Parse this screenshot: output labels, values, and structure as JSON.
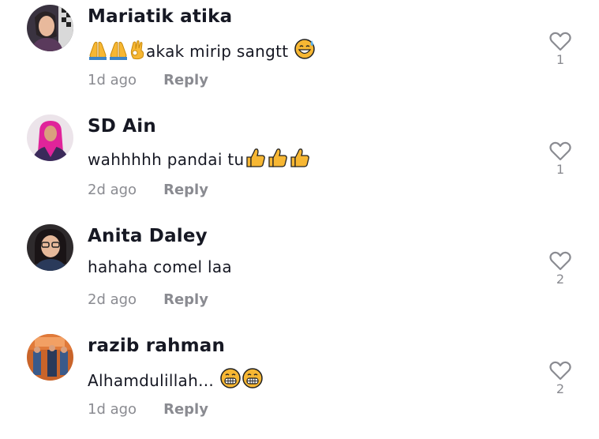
{
  "comments": [
    {
      "username": "Mariatik atika",
      "emoji_before": [
        "folded-hands",
        "folded-hands",
        "ok-hand"
      ],
      "text": "akak mirip sangtt",
      "emoji_after": [
        "grinning-sweat"
      ],
      "time": "1d ago",
      "reply_label": "Reply",
      "likes": "1"
    },
    {
      "username": "SD Ain",
      "emoji_before": [],
      "text": "wahhhhh pandai tu",
      "emoji_after": [
        "thumbs-up",
        "thumbs-up",
        "thumbs-up"
      ],
      "time": "2d ago",
      "reply_label": "Reply",
      "likes": "1"
    },
    {
      "username": "Anita Daley",
      "emoji_before": [],
      "text": "hahaha comel laa",
      "emoji_after": [],
      "time": "2d ago",
      "reply_label": "Reply",
      "likes": "2"
    },
    {
      "username": "razib rahman",
      "emoji_before": [],
      "text": "Alhamdulillah... ",
      "emoji_after": [
        "grimacing",
        "grimacing"
      ],
      "time": "1d ago",
      "reply_label": "Reply",
      "likes": "2"
    }
  ],
  "colors": {
    "text_primary": "#161823",
    "text_secondary": "#8a8b91",
    "emoji_yellow": "#f7b733"
  }
}
